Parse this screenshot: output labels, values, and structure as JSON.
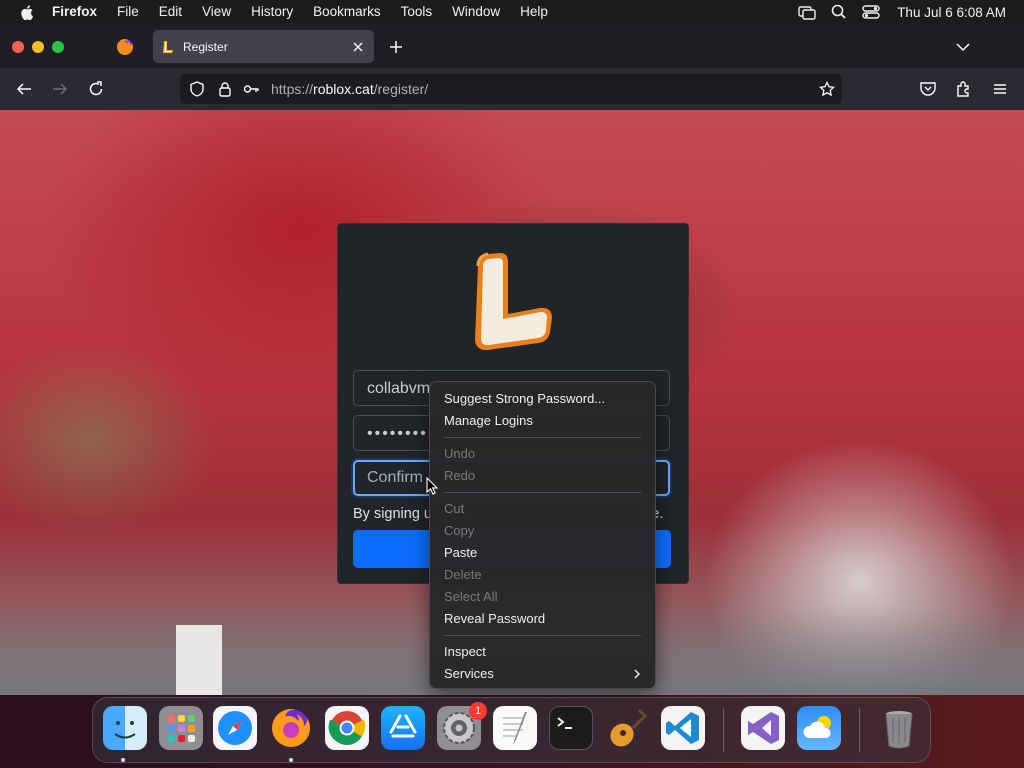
{
  "menubar": {
    "app_name": "Firefox",
    "menus": [
      "File",
      "Edit",
      "View",
      "History",
      "Bookmarks",
      "Tools",
      "Window",
      "Help"
    ],
    "clock": "Thu Jul 6  6:08 AM",
    "status_icons": [
      "screen-mirroring-icon",
      "spotlight-search-icon",
      "control-center-icon"
    ]
  },
  "browser": {
    "active_tab_title": "Register",
    "url_prefix": "https://",
    "url_host": "roblox.cat",
    "url_path": "/register/"
  },
  "page": {
    "username_value": "collabvm",
    "password_value": "••••••••",
    "confirm_placeholder": "Confirm",
    "terms_prefix": "By signing u",
    "terms_suffix": "ce.",
    "accent_color": "#0d6efd"
  },
  "context_menu": {
    "items": [
      {
        "label": "Suggest Strong Password...",
        "enabled": true
      },
      {
        "label": "Manage Logins",
        "enabled": true
      },
      {
        "label": "Undo",
        "enabled": false
      },
      {
        "label": "Redo",
        "enabled": false
      },
      {
        "label": "Cut",
        "enabled": false
      },
      {
        "label": "Copy",
        "enabled": false
      },
      {
        "label": "Paste",
        "enabled": true
      },
      {
        "label": "Delete",
        "enabled": false
      },
      {
        "label": "Select All",
        "enabled": false
      },
      {
        "label": "Reveal Password",
        "enabled": true
      },
      {
        "label": "Inspect",
        "enabled": true
      },
      {
        "label": "Services",
        "enabled": true
      }
    ]
  },
  "dock": {
    "apps": [
      "Finder",
      "Launchpad",
      "Safari",
      "Firefox",
      "Google Chrome",
      "App Store",
      "System Settings",
      "TextEdit",
      "Terminal",
      "GarageBand",
      "Visual Studio Code",
      "Visual Studio",
      "Weather",
      "Trash"
    ],
    "system_settings_badge": "1"
  }
}
